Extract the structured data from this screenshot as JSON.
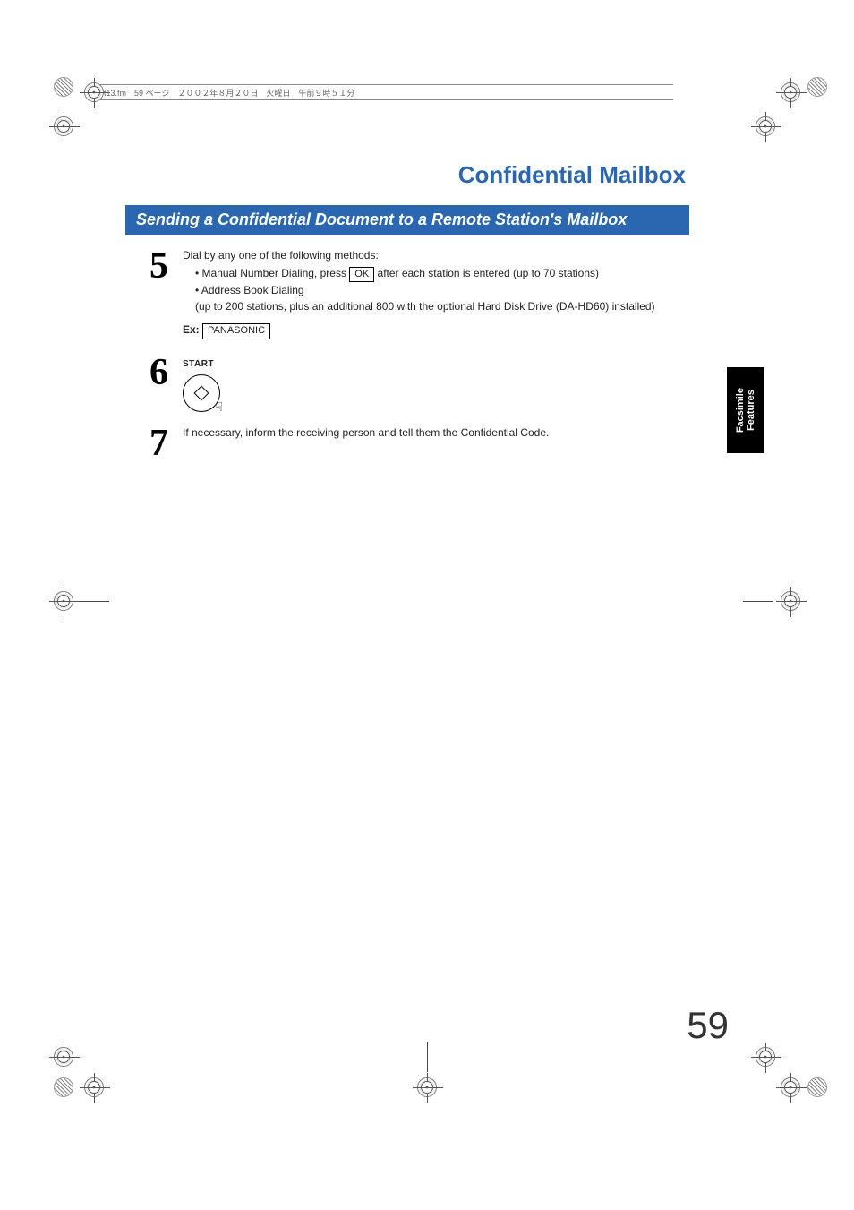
{
  "header_strip": "t13.fm　59 ページ　２００２年８月２０日　火曜日　午前９時５１分",
  "chapter_title": "Confidential Mailbox",
  "section_title": "Sending a Confidential Document to a Remote Station's Mailbox",
  "steps": {
    "5": {
      "num": "5",
      "intro": "Dial by any one of the following methods:",
      "bul1_pre": "• Manual Number Dialing, press ",
      "bul1_key": "OK",
      "bul1_post": " after each station is entered (up to 70 stations)",
      "bul2_a": "• Address Book Dialing",
      "bul2_b": "(up to 200 stations, plus an additional 800 with the optional Hard Disk Drive (DA-HD60) installed)",
      "ex_label": "Ex:",
      "ex_value": "PANASONIC"
    },
    "6": {
      "num": "6",
      "start_label": "START"
    },
    "7": {
      "num": "7",
      "text": "If necessary, inform the receiving person and tell them the Confidential Code."
    }
  },
  "side_tab_line1": "Facsimile",
  "side_tab_line2": "Features",
  "page_number": "59"
}
